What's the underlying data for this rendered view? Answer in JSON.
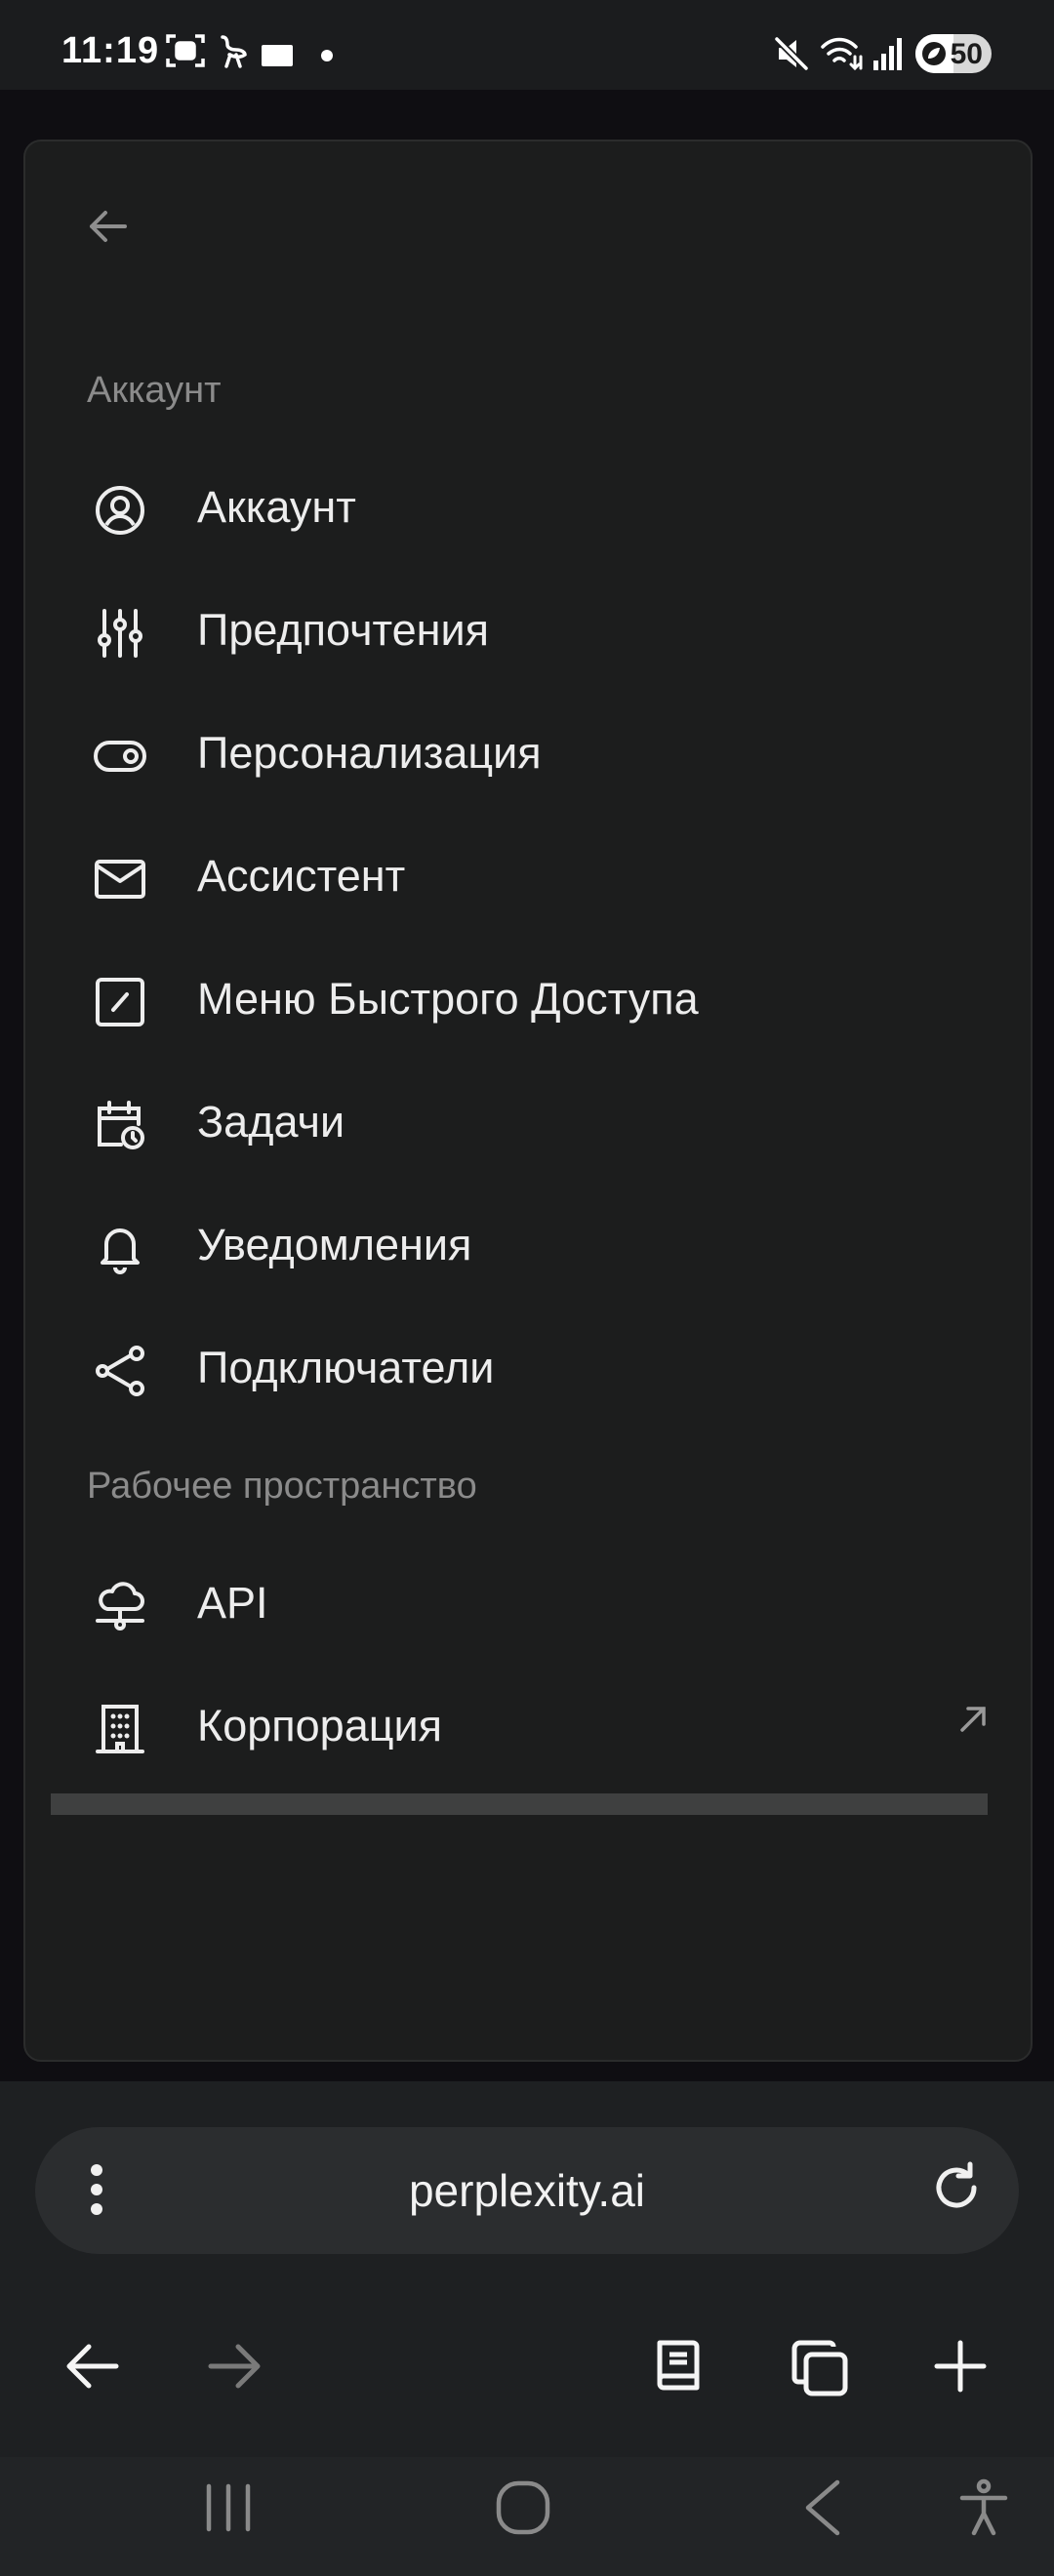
{
  "status_bar": {
    "time": "11:19",
    "battery_level": 50,
    "battery_text": "50",
    "icons": [
      "screenshot-icon",
      "ostrich-icon",
      "rectangle-icon",
      "dot-icon",
      "mute-icon",
      "wifi-icon",
      "signal-icon",
      "battery-icon"
    ]
  },
  "panel": {
    "back_icon": "arrow-left-icon",
    "sections": [
      {
        "title": "Аккаунт",
        "items": [
          {
            "label": "Аккаунт",
            "icon": "user-circle-icon"
          },
          {
            "label": "Предпочтения",
            "icon": "sliders-icon"
          },
          {
            "label": "Персонализация",
            "icon": "toggle-icon"
          },
          {
            "label": "Ассистент",
            "icon": "mail-icon"
          },
          {
            "label": "Меню Быстрого Доступа",
            "icon": "shortcut-square-icon"
          },
          {
            "label": "Задачи",
            "icon": "calendar-clock-icon"
          },
          {
            "label": "Уведомления",
            "icon": "bell-icon"
          },
          {
            "label": "Подключатели",
            "icon": "share-nodes-icon"
          }
        ]
      },
      {
        "title": "Рабочее пространство",
        "items": [
          {
            "label": "API",
            "icon": "cloud-network-icon"
          },
          {
            "label": "Корпорация",
            "icon": "building-icon",
            "external_icon": "arrow-up-right-icon"
          }
        ]
      }
    ]
  },
  "browser": {
    "url": "perplexity.ai",
    "toolbar": [
      "back-arrow-icon",
      "forward-arrow-icon",
      "book-icon",
      "tabs-icon",
      "plus-icon"
    ]
  },
  "nav_bar": [
    "recent-apps-icon",
    "home-icon",
    "back-icon",
    "accessibility-icon"
  ],
  "colors": {
    "panel_bg": "#1c1d1d",
    "page_bg": "#0f0e12",
    "section_title": "#8b8b8b",
    "item_text": "#ededed"
  }
}
